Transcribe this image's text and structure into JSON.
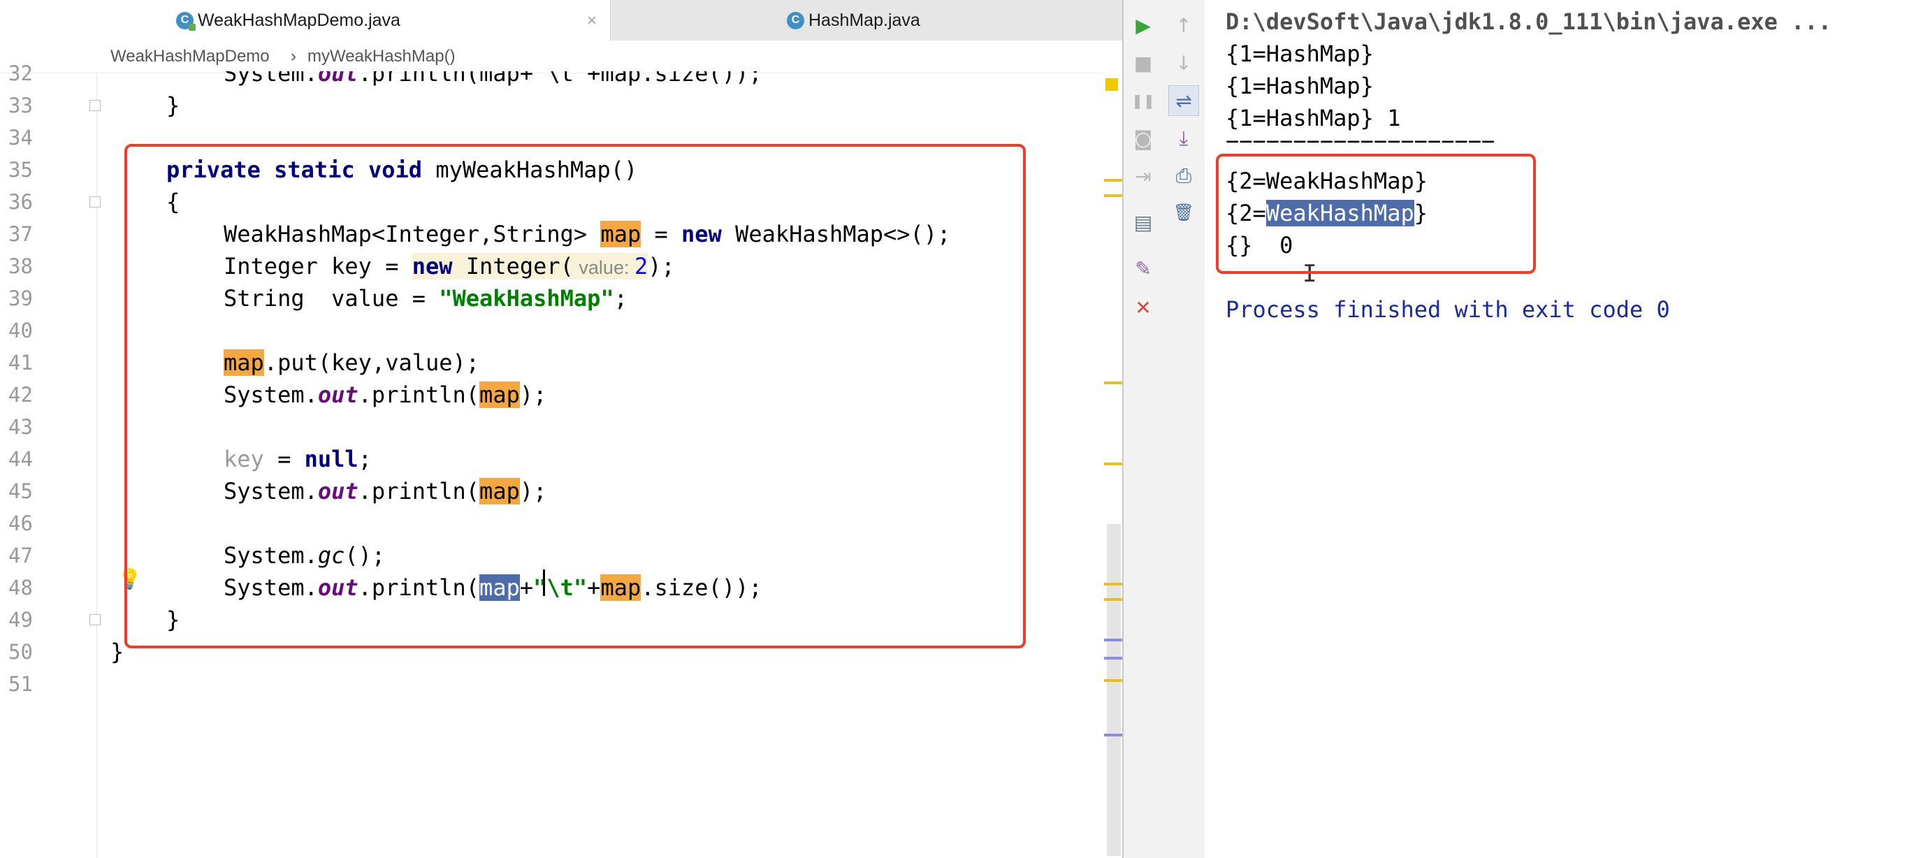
{
  "tabs": [
    {
      "label": "WeakHashMapDemo.java",
      "icon": "class-icon",
      "icon_glyph": "C",
      "active": true,
      "close": "×"
    },
    {
      "label": "HashMap.java",
      "icon": "locked-class-icon",
      "icon_glyph": "C",
      "active": false
    }
  ],
  "breadcrumb": {
    "items": [
      "WeakHashMapDemo",
      "myWeakHashMap()"
    ],
    "separator": "›"
  },
  "gutter": {
    "line_numbers": [
      "32",
      "33",
      "34",
      "35",
      "36",
      "37",
      "38",
      "39",
      "40",
      "41",
      "42",
      "43",
      "44",
      "45",
      "46",
      "47",
      "48",
      "49",
      "50",
      "51"
    ]
  },
  "code": {
    "l32a": "System.",
    "l32b": "out",
    "l32c": ".println(map+\"\\t\"+map.size());",
    "l33": "}",
    "l35_kw": "private static void",
    "l35_rest": " myWeakHashMap()",
    "l36": "{",
    "l37_a": "WeakHashMap<Integer,String> ",
    "l37_map": "map",
    "l37_b": " = ",
    "l37_new": "new",
    "l37_c": " WeakHashMap<>();",
    "l38_a": "Integer key = ",
    "l38_new": "new",
    "l38_b": " Integer(",
    "l38_hint": " value: ",
    "l38_num": "2",
    "l38_c": ");",
    "l39_a": "String  value = ",
    "l39_str": "\"WeakHashMap\"",
    "l39_b": ";",
    "l41_map": "map",
    "l41_rest": ".put(key,value);",
    "l42_a": "System.",
    "l42_out": "out",
    "l42_b": ".println(",
    "l42_map": "map",
    "l42_c": ");",
    "l44_key": "key",
    "l44_b": " = ",
    "l44_null": "null",
    "l44_c": ";",
    "l45_a": "System.",
    "l45_out": "out",
    "l45_b": ".println(",
    "l45_map": "map",
    "l45_c": ");",
    "l47_a": "System.",
    "l47_gc": "gc",
    "l47_b": "();",
    "l48_a": "System.",
    "l48_out": "out",
    "l48_b": ".println(",
    "l48_map1": "map",
    "l48_plus": "+",
    "l48_str": "\"\\t\"",
    "l48_plus2": "+",
    "l48_map2": "map",
    "l48_c": ".size());",
    "l49": "}",
    "l50": "}"
  },
  "run_toolbar": {
    "col1": [
      {
        "name": "rerun-icon",
        "glyph": "▶",
        "color": "#3aa53a"
      },
      {
        "name": "stop-icon",
        "glyph": "■",
        "color": "#b8b8b8"
      },
      {
        "name": "pause-icon",
        "glyph": "❚❚",
        "color": "#b8b8b8"
      },
      {
        "name": "camera-icon",
        "glyph": "◙",
        "color": "#b8b8b8"
      },
      {
        "name": "login-icon",
        "glyph": "⇥",
        "color": "#b8b8b8"
      },
      {
        "name": "layout-icon",
        "glyph": "▤",
        "color": "#6a7a8a"
      },
      {
        "name": "pin-icon",
        "glyph": "✎",
        "color": "#8a6aa0"
      },
      {
        "name": "close-icon",
        "glyph": "✕",
        "color": "#d94a3a"
      }
    ],
    "col2": [
      {
        "name": "up-arrow-icon",
        "glyph": "↑",
        "color": "#b8b8b8"
      },
      {
        "name": "down-arrow-icon",
        "glyph": "↓",
        "color": "#b8b8b8"
      },
      {
        "name": "soft-wrap-icon",
        "glyph": "⇌",
        "color": "#4a6fa0"
      },
      {
        "name": "scroll-to-end-icon",
        "glyph": "⤓",
        "color": "#8a5aa0"
      },
      {
        "name": "print-icon",
        "glyph": "⎙",
        "color": "#4a6fa0"
      },
      {
        "name": "trash-icon",
        "glyph": "🗑",
        "color": "#4a6fa0"
      }
    ]
  },
  "console": {
    "command": "D:\\devSoft\\Java\\jdk1.8.0_111\\bin\\java.exe ...",
    "lines": [
      "{1=HashMap}",
      "{1=HashMap}",
      "{1=HashMap} 1",
      "===================="
    ],
    "weak1": "{2=WeakHashMap}",
    "weak2_prefix": "{2=",
    "weak2_sel": "WeakHashMap",
    "weak2_suffix": "}",
    "weak3": "{}  0",
    "process": "Process finished with exit code 0"
  },
  "colors": {
    "highlight_box": "#f03c28",
    "keyword": "#000080",
    "string": "#008000",
    "selection": "#4d6ca8",
    "usage_highlight": "#f5a742"
  }
}
